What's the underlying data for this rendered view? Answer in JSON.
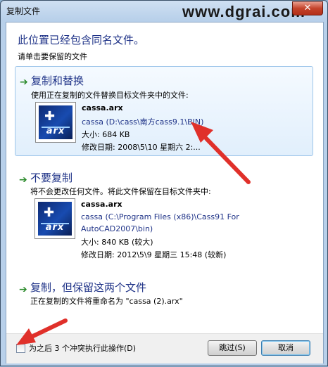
{
  "window": {
    "title": "复制文件",
    "close_glyph": "✕"
  },
  "watermark": "www.dgrai.com",
  "heading": "此位置已经包含同名文件。",
  "subheading": "请单击要保留的文件",
  "options": {
    "replace": {
      "title": "复制和替换",
      "description": "使用正在复制的文件替换目标文件夹中的文件:",
      "file_name": "cassa.arx",
      "path": "cassa (D:\\cass\\南方cass9.1\\BIN)",
      "size": "大小: 684 KB",
      "modified": "修改日期: 2008\\5\\10 星期六 2:..."
    },
    "skip": {
      "title": "不要复制",
      "description": "将不会更改任何文件。将此文件保留在目标文件夹中:",
      "file_name": "cassa.arx",
      "path_line1": "cassa (C:\\Program Files (x86)\\Cass91 For",
      "path_line2": "AutoCAD2007\\bin)",
      "size": "大小: 840 KB (较大)",
      "modified": "修改日期: 2012\\5\\9 星期三 15:48 (较新)"
    },
    "keep_both": {
      "title": "复制，但保留这两个文件",
      "description": "正在复制的文件将重命名为 \"cassa (2).arx\""
    }
  },
  "footer": {
    "checkbox_label": "为之后 3 个冲突执行此操作(D)",
    "skip_button": "跳过(S)",
    "cancel_button": "取消"
  },
  "icons": {
    "option_arrow": "arrow-right-icon",
    "file_icon_text": "arx"
  },
  "colors": {
    "link_blue": "#1e3287",
    "annotation_red": "#e0302a",
    "arrow_green": "#2a8a2a"
  }
}
